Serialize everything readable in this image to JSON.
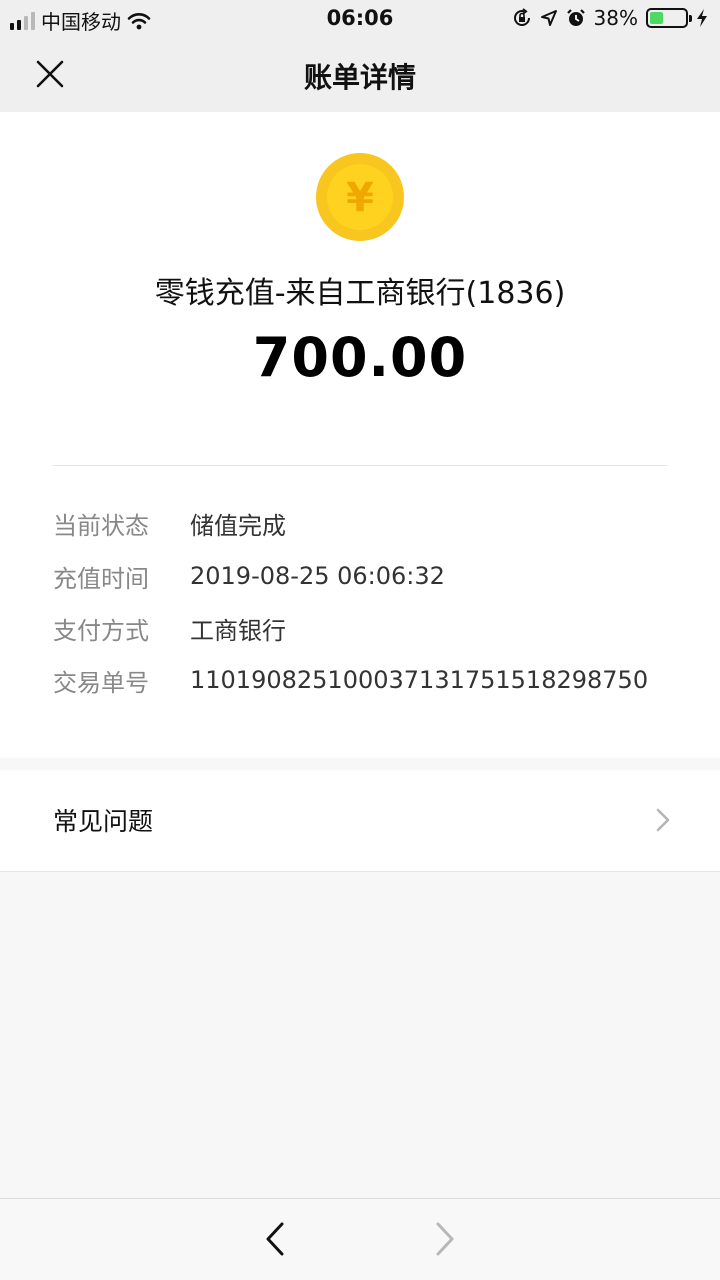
{
  "status_bar": {
    "carrier": "中国移动",
    "time": "06:06",
    "battery_percent": "38%",
    "battery_level": 0.38,
    "icons": [
      "signal-icon",
      "wifi-icon",
      "orientation-lock-icon",
      "location-icon",
      "alarm-icon",
      "battery-icon",
      "charging-icon"
    ]
  },
  "nav": {
    "title": "账单详情",
    "close_icon": "close-icon"
  },
  "bill": {
    "coin_icon": "yuan-coin-icon",
    "coin_symbol": "¥",
    "title": "零钱充值-来自工商银行(1836)",
    "amount": "700.00"
  },
  "details": [
    {
      "label": "当前状态",
      "value": "储值完成"
    },
    {
      "label": "充值时间",
      "value": "2019-08-25 06:06:32"
    },
    {
      "label": "支付方式",
      "value": "工商银行"
    },
    {
      "label": "交易单号",
      "value": "110190825100037131751518298750"
    }
  ],
  "faq": {
    "label": "常见问题",
    "icon": "chevron-right-icon"
  },
  "toolbar": {
    "back_icon": "back-arrow-icon",
    "forward_icon": "forward-arrow-icon"
  },
  "colors": {
    "accent_coin": "#f8c61e",
    "coin_symbol": "#f0a800",
    "battery_fill": "#4cd964",
    "label_gray": "#888888"
  }
}
